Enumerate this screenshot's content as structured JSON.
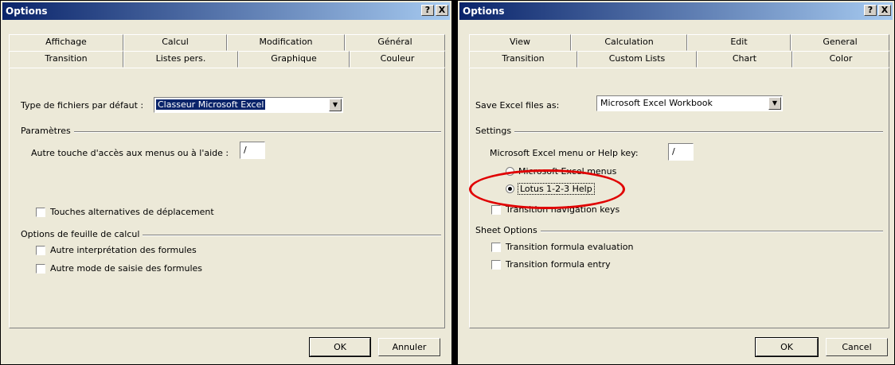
{
  "french": {
    "title": "Options",
    "help_btn": "?",
    "close_btn": "X",
    "tabs_row1": [
      "Affichage",
      "Calcul",
      "Modification",
      "Général"
    ],
    "tabs_row2": [
      "Transition",
      "Listes pers.",
      "Graphique",
      "Couleur"
    ],
    "save_label": "Type de fichiers par défaut :",
    "save_value": "Classeur Microsoft Excel",
    "settings_group": "Paramètres",
    "menu_key_label": "Autre touche d'accès aux menus ou à l'aide :",
    "menu_key_value": "/",
    "nav_keys_label": "Touches alternatives de déplacement",
    "sheet_group": "Options de feuille de calcul",
    "formula_eval_label": "Autre interprétation des formules",
    "formula_entry_label": "Autre mode de saisie des formules",
    "ok": "OK",
    "cancel": "Annuler"
  },
  "english": {
    "title": "Options",
    "help_btn": "?",
    "close_btn": "X",
    "tabs_row1": [
      "View",
      "Calculation",
      "Edit",
      "General"
    ],
    "tabs_row2": [
      "Transition",
      "Custom Lists",
      "Chart",
      "Color"
    ],
    "save_label": "Save Excel files as:",
    "save_value": "Microsoft Excel Workbook",
    "settings_group": "Settings",
    "menu_key_label": "Microsoft Excel menu or Help key:",
    "menu_key_value": "/",
    "radio_excel_label": "Microsoft Excel menus",
    "radio_lotus_label": "Lotus 1-2-3 Help",
    "nav_keys_label": "Transition navigation keys",
    "sheet_group": "Sheet Options",
    "formula_eval_label": "Transition formula evaluation",
    "formula_entry_label": "Transition formula entry",
    "ok": "OK",
    "cancel": "Cancel"
  },
  "colors": {
    "highlight_ellipse": "#e00000",
    "titlebar": "#0a246a"
  }
}
